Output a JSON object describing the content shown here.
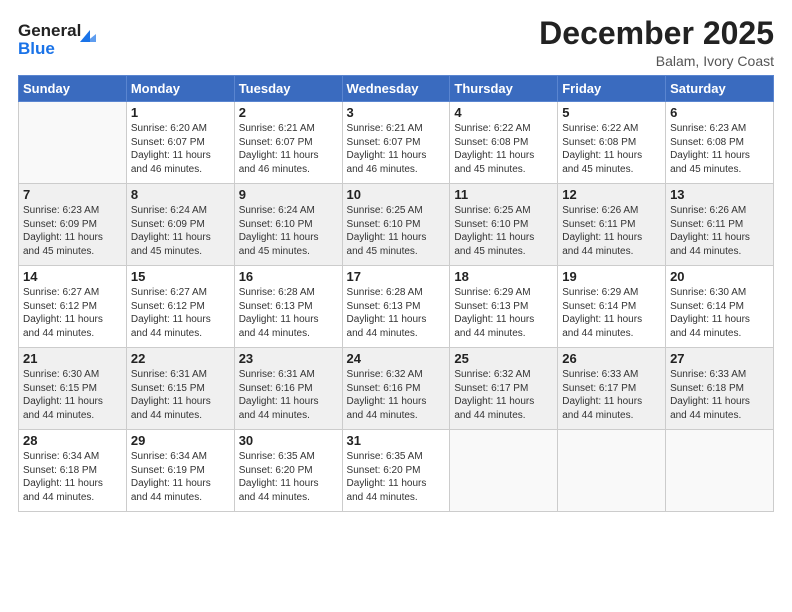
{
  "header": {
    "logo_line1": "General",
    "logo_line2": "Blue",
    "month": "December 2025",
    "location": "Balam, Ivory Coast"
  },
  "weekdays": [
    "Sunday",
    "Monday",
    "Tuesday",
    "Wednesday",
    "Thursday",
    "Friday",
    "Saturday"
  ],
  "weeks": [
    [
      {
        "day": "",
        "sunrise": "",
        "sunset": "",
        "daylight": ""
      },
      {
        "day": "1",
        "sunrise": "Sunrise: 6:20 AM",
        "sunset": "Sunset: 6:07 PM",
        "daylight": "Daylight: 11 hours and 46 minutes."
      },
      {
        "day": "2",
        "sunrise": "Sunrise: 6:21 AM",
        "sunset": "Sunset: 6:07 PM",
        "daylight": "Daylight: 11 hours and 46 minutes."
      },
      {
        "day": "3",
        "sunrise": "Sunrise: 6:21 AM",
        "sunset": "Sunset: 6:07 PM",
        "daylight": "Daylight: 11 hours and 46 minutes."
      },
      {
        "day": "4",
        "sunrise": "Sunrise: 6:22 AM",
        "sunset": "Sunset: 6:08 PM",
        "daylight": "Daylight: 11 hours and 45 minutes."
      },
      {
        "day": "5",
        "sunrise": "Sunrise: 6:22 AM",
        "sunset": "Sunset: 6:08 PM",
        "daylight": "Daylight: 11 hours and 45 minutes."
      },
      {
        "day": "6",
        "sunrise": "Sunrise: 6:23 AM",
        "sunset": "Sunset: 6:08 PM",
        "daylight": "Daylight: 11 hours and 45 minutes."
      }
    ],
    [
      {
        "day": "7",
        "sunrise": "Sunrise: 6:23 AM",
        "sunset": "Sunset: 6:09 PM",
        "daylight": "Daylight: 11 hours and 45 minutes."
      },
      {
        "day": "8",
        "sunrise": "Sunrise: 6:24 AM",
        "sunset": "Sunset: 6:09 PM",
        "daylight": "Daylight: 11 hours and 45 minutes."
      },
      {
        "day": "9",
        "sunrise": "Sunrise: 6:24 AM",
        "sunset": "Sunset: 6:10 PM",
        "daylight": "Daylight: 11 hours and 45 minutes."
      },
      {
        "day": "10",
        "sunrise": "Sunrise: 6:25 AM",
        "sunset": "Sunset: 6:10 PM",
        "daylight": "Daylight: 11 hours and 45 minutes."
      },
      {
        "day": "11",
        "sunrise": "Sunrise: 6:25 AM",
        "sunset": "Sunset: 6:10 PM",
        "daylight": "Daylight: 11 hours and 45 minutes."
      },
      {
        "day": "12",
        "sunrise": "Sunrise: 6:26 AM",
        "sunset": "Sunset: 6:11 PM",
        "daylight": "Daylight: 11 hours and 44 minutes."
      },
      {
        "day": "13",
        "sunrise": "Sunrise: 6:26 AM",
        "sunset": "Sunset: 6:11 PM",
        "daylight": "Daylight: 11 hours and 44 minutes."
      }
    ],
    [
      {
        "day": "14",
        "sunrise": "Sunrise: 6:27 AM",
        "sunset": "Sunset: 6:12 PM",
        "daylight": "Daylight: 11 hours and 44 minutes."
      },
      {
        "day": "15",
        "sunrise": "Sunrise: 6:27 AM",
        "sunset": "Sunset: 6:12 PM",
        "daylight": "Daylight: 11 hours and 44 minutes."
      },
      {
        "day": "16",
        "sunrise": "Sunrise: 6:28 AM",
        "sunset": "Sunset: 6:13 PM",
        "daylight": "Daylight: 11 hours and 44 minutes."
      },
      {
        "day": "17",
        "sunrise": "Sunrise: 6:28 AM",
        "sunset": "Sunset: 6:13 PM",
        "daylight": "Daylight: 11 hours and 44 minutes."
      },
      {
        "day": "18",
        "sunrise": "Sunrise: 6:29 AM",
        "sunset": "Sunset: 6:13 PM",
        "daylight": "Daylight: 11 hours and 44 minutes."
      },
      {
        "day": "19",
        "sunrise": "Sunrise: 6:29 AM",
        "sunset": "Sunset: 6:14 PM",
        "daylight": "Daylight: 11 hours and 44 minutes."
      },
      {
        "day": "20",
        "sunrise": "Sunrise: 6:30 AM",
        "sunset": "Sunset: 6:14 PM",
        "daylight": "Daylight: 11 hours and 44 minutes."
      }
    ],
    [
      {
        "day": "21",
        "sunrise": "Sunrise: 6:30 AM",
        "sunset": "Sunset: 6:15 PM",
        "daylight": "Daylight: 11 hours and 44 minutes."
      },
      {
        "day": "22",
        "sunrise": "Sunrise: 6:31 AM",
        "sunset": "Sunset: 6:15 PM",
        "daylight": "Daylight: 11 hours and 44 minutes."
      },
      {
        "day": "23",
        "sunrise": "Sunrise: 6:31 AM",
        "sunset": "Sunset: 6:16 PM",
        "daylight": "Daylight: 11 hours and 44 minutes."
      },
      {
        "day": "24",
        "sunrise": "Sunrise: 6:32 AM",
        "sunset": "Sunset: 6:16 PM",
        "daylight": "Daylight: 11 hours and 44 minutes."
      },
      {
        "day": "25",
        "sunrise": "Sunrise: 6:32 AM",
        "sunset": "Sunset: 6:17 PM",
        "daylight": "Daylight: 11 hours and 44 minutes."
      },
      {
        "day": "26",
        "sunrise": "Sunrise: 6:33 AM",
        "sunset": "Sunset: 6:17 PM",
        "daylight": "Daylight: 11 hours and 44 minutes."
      },
      {
        "day": "27",
        "sunrise": "Sunrise: 6:33 AM",
        "sunset": "Sunset: 6:18 PM",
        "daylight": "Daylight: 11 hours and 44 minutes."
      }
    ],
    [
      {
        "day": "28",
        "sunrise": "Sunrise: 6:34 AM",
        "sunset": "Sunset: 6:18 PM",
        "daylight": "Daylight: 11 hours and 44 minutes."
      },
      {
        "day": "29",
        "sunrise": "Sunrise: 6:34 AM",
        "sunset": "Sunset: 6:19 PM",
        "daylight": "Daylight: 11 hours and 44 minutes."
      },
      {
        "day": "30",
        "sunrise": "Sunrise: 6:35 AM",
        "sunset": "Sunset: 6:20 PM",
        "daylight": "Daylight: 11 hours and 44 minutes."
      },
      {
        "day": "31",
        "sunrise": "Sunrise: 6:35 AM",
        "sunset": "Sunset: 6:20 PM",
        "daylight": "Daylight: 11 hours and 44 minutes."
      },
      {
        "day": "",
        "sunrise": "",
        "sunset": "",
        "daylight": ""
      },
      {
        "day": "",
        "sunrise": "",
        "sunset": "",
        "daylight": ""
      },
      {
        "day": "",
        "sunrise": "",
        "sunset": "",
        "daylight": ""
      }
    ]
  ]
}
